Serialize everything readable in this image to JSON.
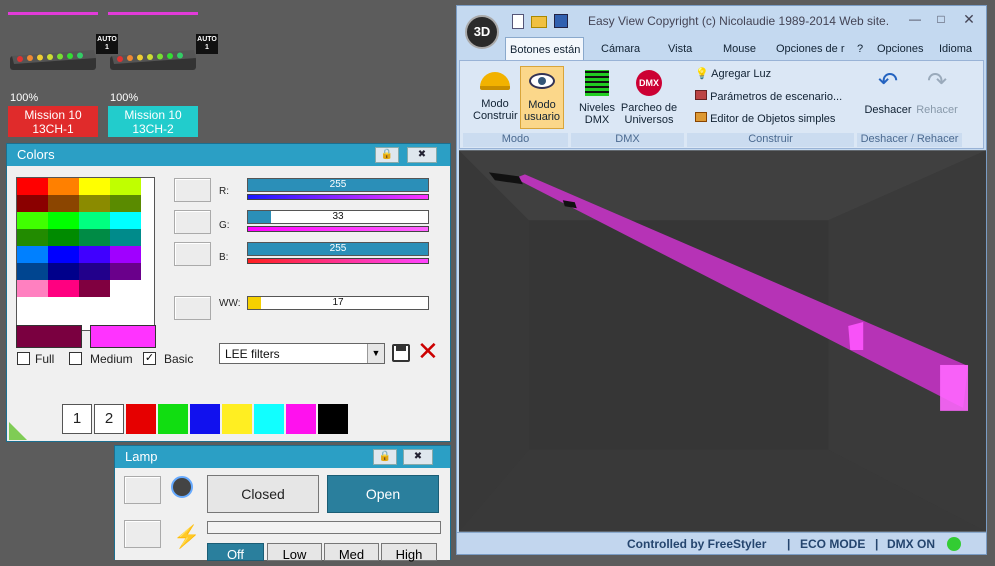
{
  "fixtures": [
    {
      "percent": "100%",
      "name_line1": "Mission 10",
      "name_line2": "13CH-1",
      "label_color": "#e02b2b",
      "auto_badge": "AUTO 1"
    },
    {
      "percent": "100%",
      "name_line1": "Mission 10",
      "name_line2": "13CH-2",
      "label_color": "#22cccc",
      "auto_badge": "AUTO 1"
    }
  ],
  "colors_panel": {
    "title": "Colors",
    "sliders": [
      {
        "label": "R:",
        "value": "255",
        "fraction": 1.0
      },
      {
        "label": "G:",
        "value": "33",
        "fraction": 0.13
      },
      {
        "label": "B:",
        "value": "255",
        "fraction": 1.0
      },
      {
        "label": "WW:",
        "value": "17",
        "fraction": 0.07
      }
    ],
    "checkboxes": [
      {
        "label": "Full",
        "checked": false
      },
      {
        "label": "Medium",
        "checked": false
      },
      {
        "label": "Basic",
        "checked": true
      }
    ],
    "filter_select": "LEE filters",
    "preset_buttons": [
      "1",
      "2"
    ],
    "palette_colors": [
      "#e60000",
      "#11dd11",
      "#1111ee",
      "#ffee22",
      "#11ffff",
      "#ff11ee",
      "#000000"
    ],
    "current_color": "#7a0040",
    "target_color": "#ff33ff"
  },
  "lamp_panel": {
    "title": "Lamp",
    "closed_label": "Closed",
    "open_label": "Open",
    "level_buttons": [
      "Off",
      "Low",
      "Med",
      "High"
    ]
  },
  "app": {
    "title": "Easy View   Copyright (c) Nicolaudie 1989-2014   Web site...",
    "logo": "3D",
    "tabs": [
      "Botones están",
      "Cámara",
      "Vista",
      "Mouse",
      "Opciones de r"
    ],
    "right_menus": [
      "?",
      "Opciones",
      "Idioma"
    ],
    "modo_construir": "Modo Construir",
    "modo_usuario": "Modo usuario",
    "niveles_dmx": "Niveles DMX",
    "parcheo": "Parcheo de Universos",
    "agregar_luz": "Agregar Luz",
    "parametros": "Parámetros de escenario...",
    "editor": "Editor de Objetos simples",
    "deshacer": "Deshacer",
    "rehacer": "Rehacer",
    "groups": [
      "Modo",
      "DMX",
      "Construir",
      "Deshacer / Rehacer"
    ],
    "status": [
      "Controlled by FreeStyler",
      "ECO MODE",
      "DMX ON"
    ]
  }
}
